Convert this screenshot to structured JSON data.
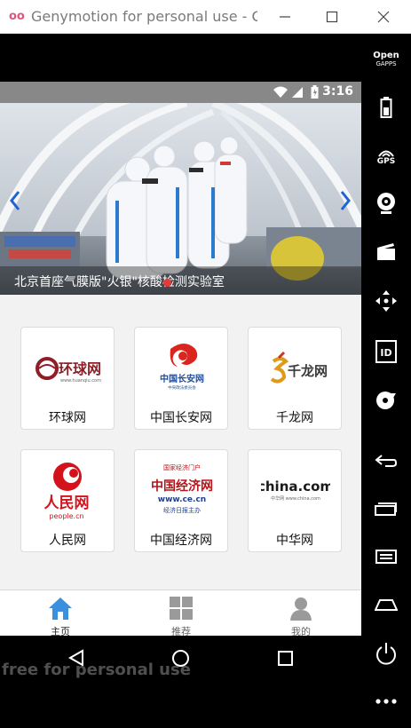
{
  "window": {
    "title": "Genymotion for personal use - C...",
    "app_logo": "oo",
    "minimize_icon": "minimize-icon",
    "maximize_icon": "maximize-icon",
    "close_icon": "close-icon"
  },
  "status_bar": {
    "time": "3:16",
    "icons": [
      "wifi-icon",
      "signal-icon",
      "battery-icon"
    ]
  },
  "banner": {
    "caption": "北京首座气膜版\"火银\"核酸检测实验室",
    "prev_icon": "chevron-left-icon",
    "next_icon": "chevron-right-icon",
    "colors": {
      "arrow": "#1e63d6",
      "indicator": "#e53935"
    }
  },
  "sites": [
    {
      "label": "环球网",
      "logo_text": "环球网",
      "logo_sub": "www.huanqiu.com"
    },
    {
      "label": "中国长安网",
      "logo_text": "中国长安网",
      "logo_sub": "中央政法委员会"
    },
    {
      "label": "千龙网",
      "logo_text": "千龙网",
      "logo_sub": ""
    },
    {
      "label": "人民网",
      "logo_text": "人民网",
      "logo_sub": "people.cn"
    },
    {
      "label": "中国经济网",
      "logo_text": "中国经济网",
      "logo_sub": "www.ce.cn",
      "logo_top": "国家经济门户",
      "logo_bottom": "经济日报主办"
    },
    {
      "label": "中华网",
      "logo_text": "china.com",
      "logo_sub": "中华网 www.china.com"
    }
  ],
  "bottom_nav": [
    {
      "label": "主页",
      "icon": "home-icon",
      "active": true
    },
    {
      "label": "推荐",
      "icon": "grid-icon",
      "active": false
    },
    {
      "label": "我的",
      "icon": "user-icon",
      "active": false
    }
  ],
  "android_nav": [
    "back-icon",
    "home-circle-icon",
    "recents-icon"
  ],
  "watermark": "free for personal use",
  "toolbar": {
    "opengapps": {
      "line1": "Open",
      "line2": "GAPPS"
    },
    "gps_label": "GPS",
    "id_label": "ID",
    "items": [
      "opengapps-icon",
      "battery-icon",
      "gps-icon",
      "webcam-icon",
      "clapper-icon",
      "move-icon",
      "id-icon",
      "disk-icon",
      "back-icon",
      "recents-icon",
      "menu-icon",
      "home-icon",
      "power-icon",
      "more-icon"
    ]
  }
}
